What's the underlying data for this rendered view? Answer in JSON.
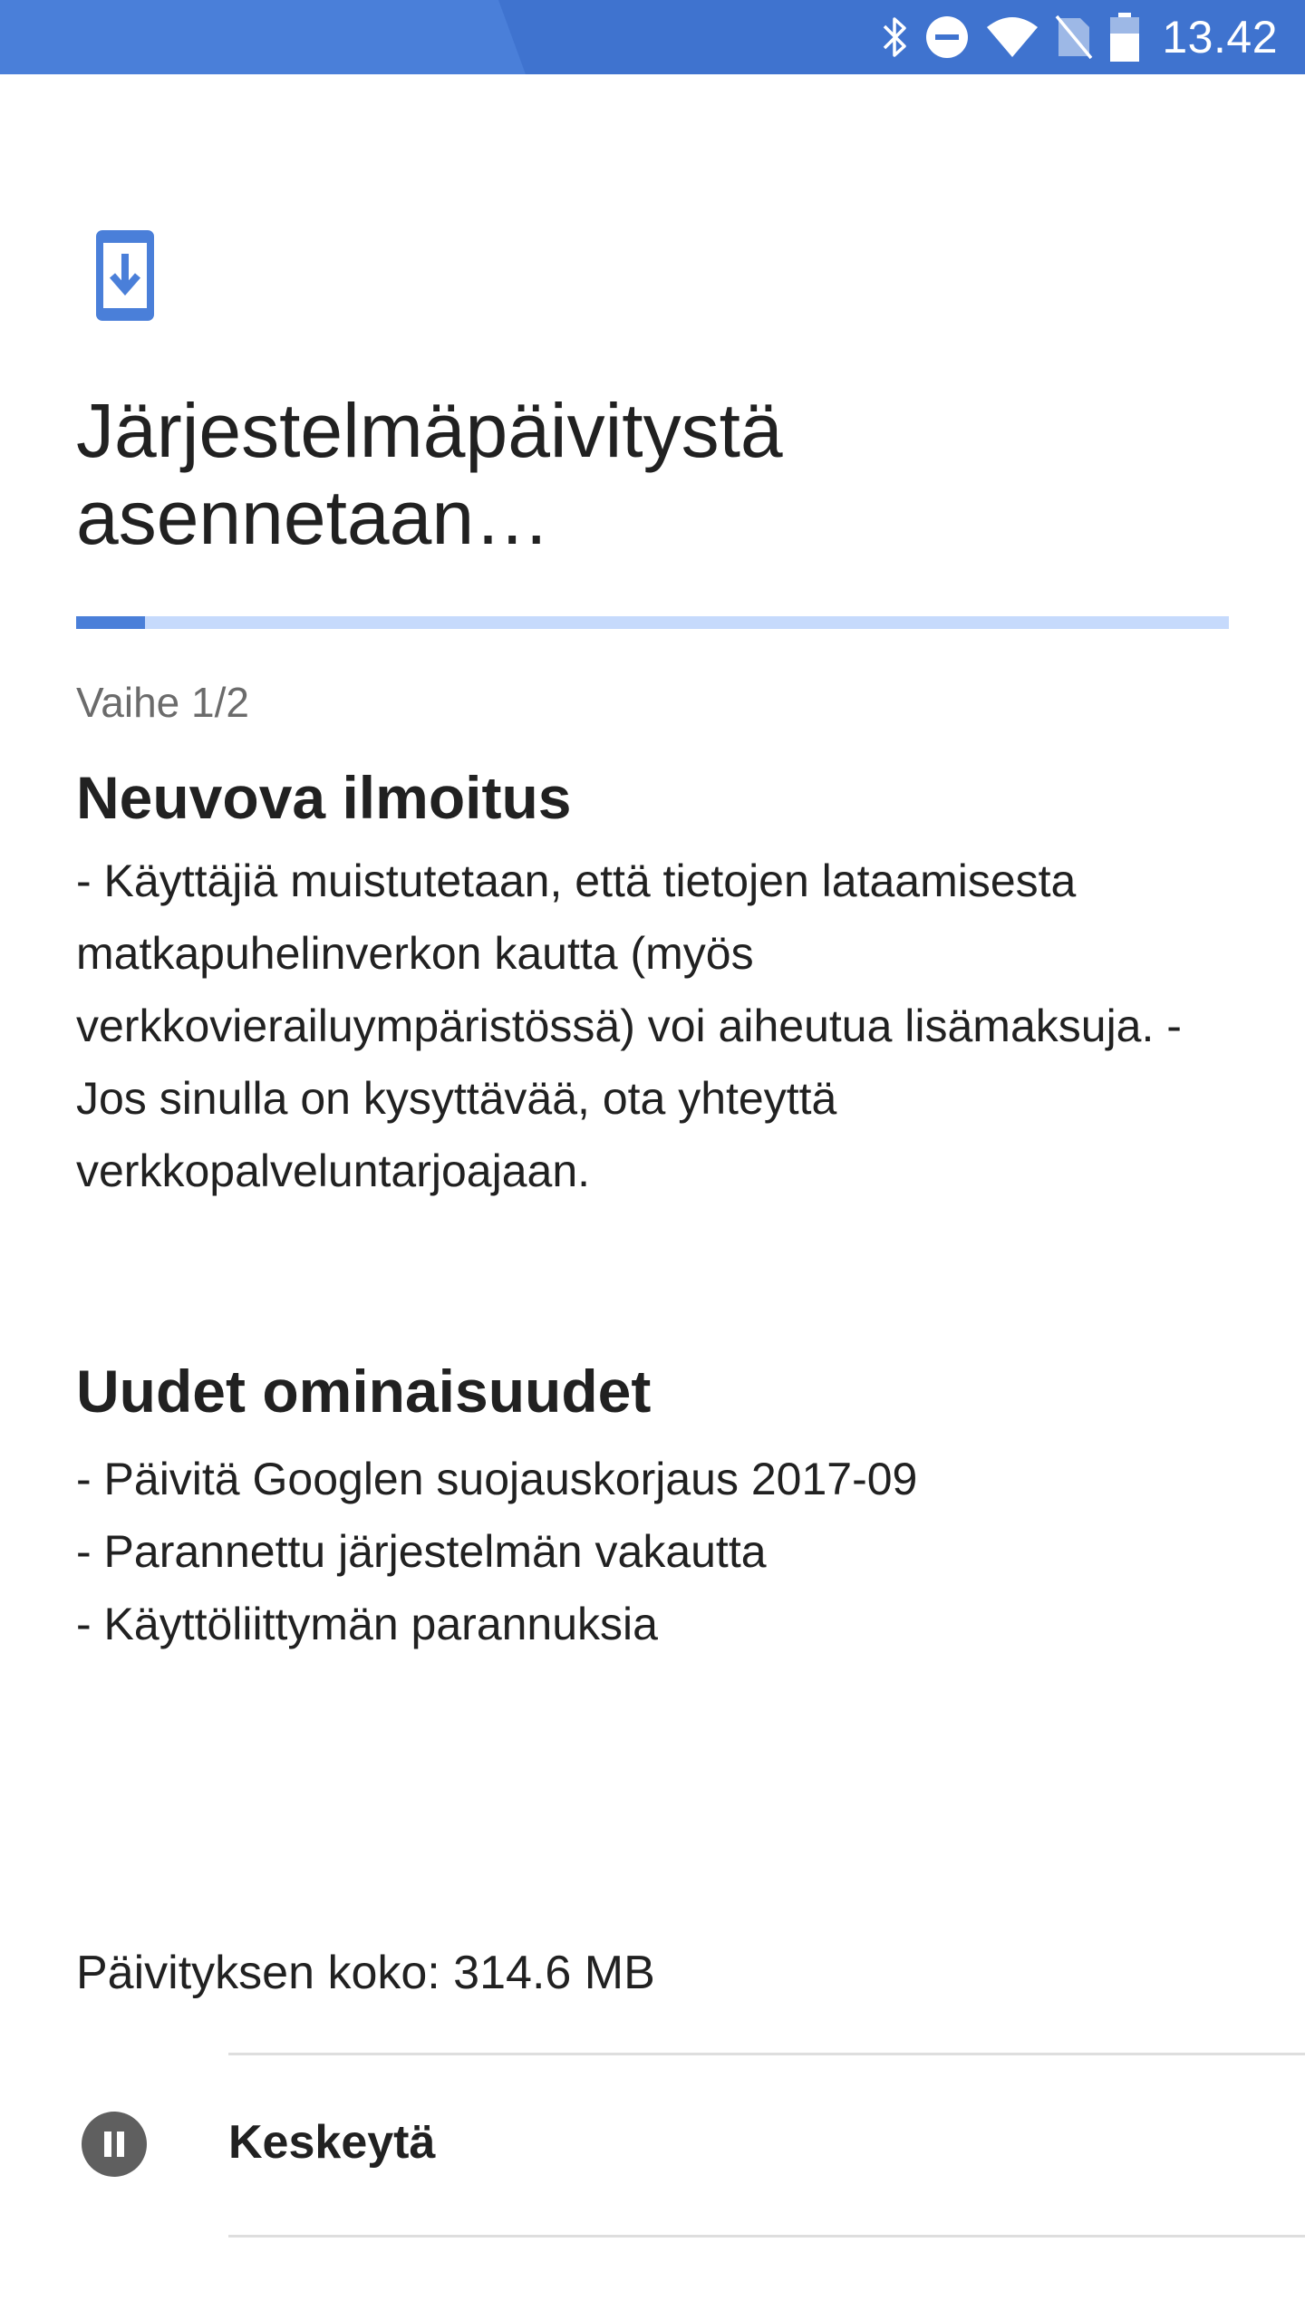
{
  "status_bar": {
    "time": "13.42",
    "icons": [
      "bluetooth-icon",
      "do-not-disturb-icon",
      "wifi-icon",
      "no-sim-icon",
      "battery-icon"
    ],
    "background_color": "#3f73cf"
  },
  "header": {
    "icon": "system-update-download-icon",
    "title": "Järjestelmäpäivitystä asennetaan…",
    "accent_color": "#4a7fd9"
  },
  "progress": {
    "fraction": 0.06
  },
  "step_label": "Vaihe 1/2",
  "notice": {
    "title": "Neuvova ilmoitus",
    "body": "- Käyttäjiä muistutetaan, että tietojen lataamisesta matkapuhelinverkon kautta (myös verkkovierailuympäristössä) voi aiheutua lisämaksuja. - Jos sinulla on kysyttävää, ota yhteyttä verkkopalveluntarjoajaan."
  },
  "features": {
    "title": "Uudet ominaisuudet",
    "items": [
      "- Päivitä Googlen suojauskorjaus 2017-09",
      "- Parannettu järjestelmän vakautta",
      "- Käyttöliittymän parannuksia"
    ]
  },
  "update_size": "Päivityksen koko: 314.6 MB",
  "pause": {
    "icon": "pause-icon",
    "label": "Keskeytä"
  }
}
